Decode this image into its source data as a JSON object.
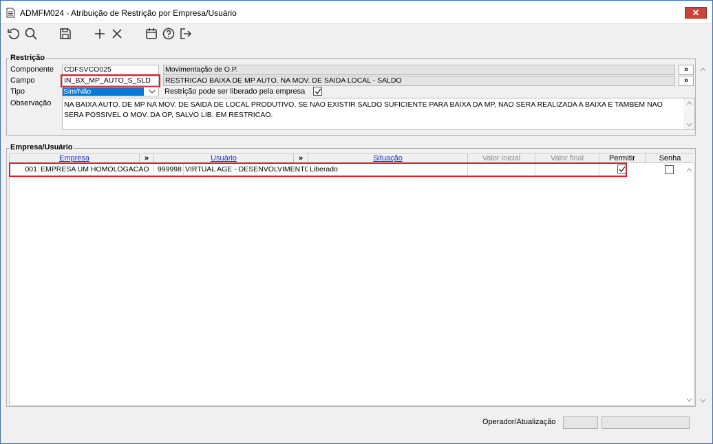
{
  "window": {
    "title": "ADMFM024 - Atribuição de Restrição por Empresa/Usuário",
    "close_label": "✕"
  },
  "toolbar": {
    "refresh_icon": "refresh-icon",
    "search_icon": "search-icon",
    "save_icon": "save-icon",
    "add_icon": "add-icon",
    "delete_icon": "delete-icon",
    "calendar_icon": "calendar-icon",
    "help_icon": "help-icon",
    "exit_icon": "exit-icon"
  },
  "restricao": {
    "group_title": "Restrição",
    "componente_label": "Componente",
    "componente_code": "CDFSVCO025",
    "componente_desc": "Movimentação de O.P.",
    "campo_label": "Campo",
    "campo_code": "IN_BX_MP_AUTO_S_SLD",
    "campo_desc": "RESTRICAO BAIXA DE MP AUTO. NA MOV. DE SAIDA LOCAL - SALDO",
    "tipo_label": "Tipo",
    "tipo_value": "Sim/Não",
    "liberado_label": "Restrição pode ser liberado pela empresa",
    "liberado_checked": true,
    "observacao_label": "Observação",
    "observacao_text": "NA BAIXA AUTO. DE MP NA MOV. DE SAIDA DE LOCAL PRODUTIVO, SE NAO EXISTIR SALDO SUFICIENTE PARA BAIXA DA MP, NAO SERA REALIZADA A BAIXA E TAMBEM NAO SERA POSSIVEL O MOV. DA OP, SALVO LIB. EM RESTRICAO.",
    "lookup_label": "»"
  },
  "empresa_usuario": {
    "group_title": "Empresa/Usuário",
    "headers": {
      "empresa": "Empresa",
      "arrow": "»",
      "usuario": "Usuário",
      "situacao": "Situação",
      "valor_inicial": "Valor inicial",
      "valor_final": "Valor final",
      "permitir": "Permitir",
      "senha": "Senha"
    },
    "rows": [
      {
        "empresa_code": "001",
        "empresa_name": "EMPRESA UM  HOMOLOGACAO",
        "usuario_code": "999998",
        "usuario_name": "VIRTUAL AGE - DESENVOLVIMENTO",
        "situacao": "Liberado",
        "valor_inicial": "",
        "valor_final": "",
        "permitir": true,
        "senha": false
      }
    ]
  },
  "footer": {
    "operador_label": "Operador/Atualização"
  },
  "colors": {
    "highlight_red": "#d9202a",
    "select_blue": "#0a78d7",
    "header_link_blue": "#1b2fc7"
  }
}
